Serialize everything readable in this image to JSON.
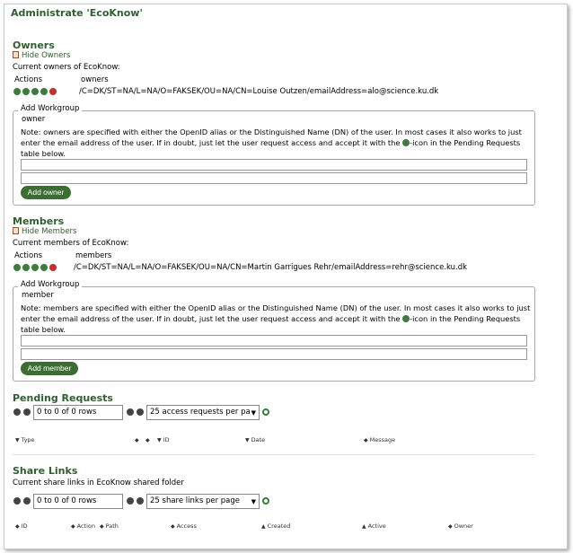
{
  "page": {
    "title": "Administrate 'EcoKnow'"
  },
  "owners": {
    "title": "Owners",
    "hide_label": "Hide Owners",
    "current_label": "Current owners of EcoKnow:",
    "col_actions": "Actions",
    "col_name": "owners",
    "rows": [
      {
        "dn": "/C=DK/ST=NA/L=NA/O=FAKSEK/OU=NA/CN=Louise Outzen/emailAddress=alo@science.ku.dk"
      }
    ],
    "form": {
      "legend": "Add Workgroup",
      "role": "owner",
      "note_before_icon": "Note: owners are specified with either the OpenID alias or the Distinguished Name (DN) of the user. In most cases it also works to just enter the email address of the user. If in doubt, just let the user request access and accept it with the ",
      "note_after_icon": "-icon in the Pending Requests table below.",
      "button": "Add owner"
    }
  },
  "members": {
    "title": "Members",
    "hide_label": "Hide Members",
    "current_label": "Current members of EcoKnow:",
    "col_actions": "Actions",
    "col_name": "members",
    "rows": [
      {
        "dn": "/C=DK/ST=NA/L=NA/O=FAKSEK/OU=NA/CN=Martin Garrigues Rehr/emailAddress=rehr@science.ku.dk"
      }
    ],
    "form": {
      "legend": "Add Workgroup",
      "role": "member",
      "note_before_icon": "Note: members are specified with either the OpenID alias or the Distinguished Name (DN) of the user. In most cases it also works to just enter the email address of the user. If in doubt, just let the user request access and accept it with the ",
      "note_after_icon": "-icon in the Pending Requests table below.",
      "button": "Add member"
    }
  },
  "pending": {
    "title": "Pending Requests",
    "pager_value": "0 to 0 of 0 rows",
    "per_page": "25 access requests per pa",
    "columns": [
      "Type",
      "ID",
      "Date",
      "Message"
    ]
  },
  "share": {
    "title": "Share Links",
    "subtitle": "Current share links in EcoKnow shared folder",
    "pager_value": "0 to 0 of 0 rows",
    "per_page": "25 share links per page",
    "columns": [
      "ID",
      "Action",
      "Path",
      "Access",
      "Created",
      "Active",
      "Owner"
    ]
  }
}
